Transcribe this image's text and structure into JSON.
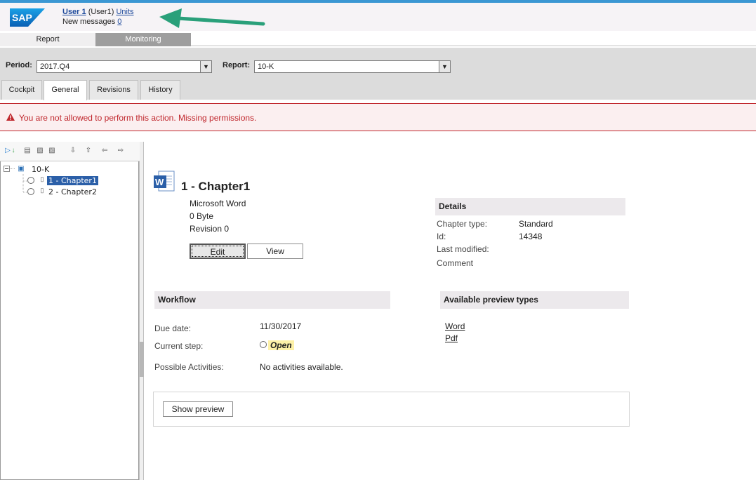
{
  "header": {
    "user_name": "User 1",
    "user_id": "(User1)",
    "units_link": "Units",
    "new_messages_label": "New messages",
    "new_messages_count": "0"
  },
  "nav": {
    "tabs": [
      {
        "label": "Report",
        "active": true
      },
      {
        "label": "Monitoring",
        "active": false
      }
    ]
  },
  "filters": {
    "period_label": "Period:",
    "period_value": "2017.Q4",
    "report_label": "Report:",
    "report_value": "10-K"
  },
  "subtabs": [
    {
      "label": "Cockpit",
      "active": false
    },
    {
      "label": "General",
      "active": true
    },
    {
      "label": "Revisions",
      "active": false
    },
    {
      "label": "History",
      "active": false
    }
  ],
  "error": {
    "message": "You are not allowed to perform this action. Missing permissions."
  },
  "tree": {
    "root": "10-K",
    "items": [
      "1 - Chapter1",
      "2 - Chapter2"
    ]
  },
  "document": {
    "title": "1 - Chapter1",
    "type": "Microsoft Word",
    "size": "0 Byte",
    "revision": "Revision 0",
    "edit_label": "Edit",
    "view_label": "View"
  },
  "details": {
    "heading": "Details",
    "chapter_type_label": "Chapter type:",
    "chapter_type_value": "Standard",
    "id_label": "Id:",
    "id_value": "14348",
    "last_modified_label": "Last modified:",
    "comment_label": "Comment"
  },
  "workflow": {
    "heading": "Workflow",
    "due_date_label": "Due date:",
    "due_date_value": "11/30/2017",
    "current_step_label": "Current step:",
    "current_step_value": "Open",
    "possible_activities_label": "Possible Activities:",
    "possible_activities_value": "No activities available."
  },
  "preview": {
    "heading": "Available preview types",
    "types": [
      "Word",
      "Pdf"
    ],
    "show_preview_label": "Show preview"
  },
  "colors": {
    "accent_blue": "#3b97d3",
    "error_red": "#c0272d",
    "arrow_green": "#2aa07a"
  }
}
